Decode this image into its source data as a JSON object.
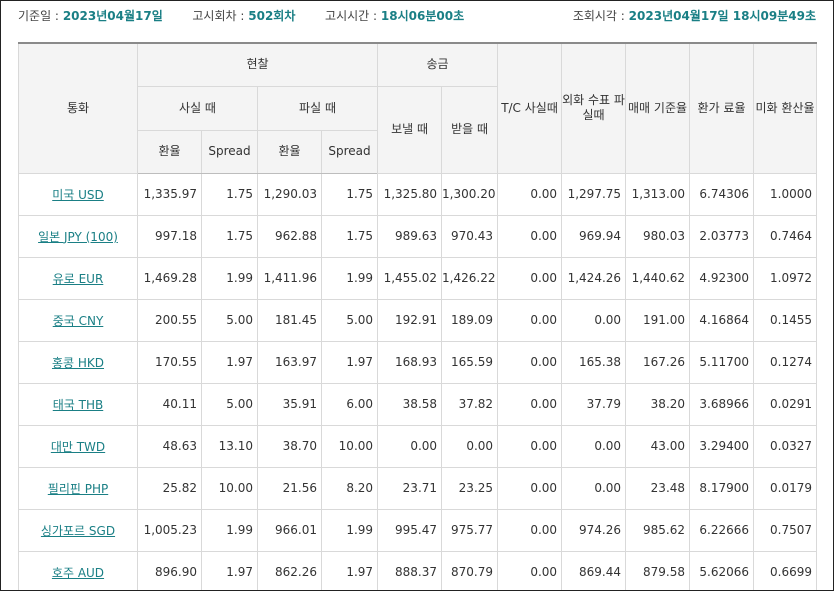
{
  "info": {
    "base_date_label": "기준일 :",
    "base_date_value": "2023년04월17일",
    "notice_round_label": "고시회차 :",
    "notice_round_value": "502회차",
    "notice_time_label": "고시시간 :",
    "notice_time_value": "18시06분00초",
    "query_time_label": "조회시각 :",
    "query_time_value": "2023년04월17일 18시09분49초"
  },
  "headers": {
    "currency": "통화",
    "cash": "현찰",
    "remit": "송금",
    "tc_buy": "T/C 사실때",
    "foreign_check_sell": "외화 수표 파실때",
    "base_rate": "매매 기준율",
    "conversion_rate": "환가 료율",
    "usd_conversion": "미화 환산율",
    "cash_buy": "사실 때",
    "cash_sell": "파실 때",
    "remit_send": "보낼 때",
    "remit_receive": "받을 때",
    "rate": "환율",
    "spread": "Spread"
  },
  "rows": [
    {
      "name": "미국 USD",
      "cash_buy_rate": "1,335.97",
      "cash_buy_spread": "1.75",
      "cash_sell_rate": "1,290.03",
      "cash_sell_spread": "1.75",
      "remit_send": "1,325.80",
      "remit_receive": "1,300.20",
      "tc_buy": "0.00",
      "check_sell": "1,297.75",
      "base_rate": "1,313.00",
      "conv_rate": "6.74306",
      "usd_conv": "1.0000"
    },
    {
      "name": "일본 JPY (100)",
      "cash_buy_rate": "997.18",
      "cash_buy_spread": "1.75",
      "cash_sell_rate": "962.88",
      "cash_sell_spread": "1.75",
      "remit_send": "989.63",
      "remit_receive": "970.43",
      "tc_buy": "0.00",
      "check_sell": "969.94",
      "base_rate": "980.03",
      "conv_rate": "2.03773",
      "usd_conv": "0.7464"
    },
    {
      "name": "유로 EUR",
      "cash_buy_rate": "1,469.28",
      "cash_buy_spread": "1.99",
      "cash_sell_rate": "1,411.96",
      "cash_sell_spread": "1.99",
      "remit_send": "1,455.02",
      "remit_receive": "1,426.22",
      "tc_buy": "0.00",
      "check_sell": "1,424.26",
      "base_rate": "1,440.62",
      "conv_rate": "4.92300",
      "usd_conv": "1.0972"
    },
    {
      "name": "중국 CNY",
      "cash_buy_rate": "200.55",
      "cash_buy_spread": "5.00",
      "cash_sell_rate": "181.45",
      "cash_sell_spread": "5.00",
      "remit_send": "192.91",
      "remit_receive": "189.09",
      "tc_buy": "0.00",
      "check_sell": "0.00",
      "base_rate": "191.00",
      "conv_rate": "4.16864",
      "usd_conv": "0.1455"
    },
    {
      "name": "홍콩 HKD",
      "cash_buy_rate": "170.55",
      "cash_buy_spread": "1.97",
      "cash_sell_rate": "163.97",
      "cash_sell_spread": "1.97",
      "remit_send": "168.93",
      "remit_receive": "165.59",
      "tc_buy": "0.00",
      "check_sell": "165.38",
      "base_rate": "167.26",
      "conv_rate": "5.11700",
      "usd_conv": "0.1274"
    },
    {
      "name": "태국 THB",
      "cash_buy_rate": "40.11",
      "cash_buy_spread": "5.00",
      "cash_sell_rate": "35.91",
      "cash_sell_spread": "6.00",
      "remit_send": "38.58",
      "remit_receive": "37.82",
      "tc_buy": "0.00",
      "check_sell": "37.79",
      "base_rate": "38.20",
      "conv_rate": "3.68966",
      "usd_conv": "0.0291"
    },
    {
      "name": "대만 TWD",
      "cash_buy_rate": "48.63",
      "cash_buy_spread": "13.10",
      "cash_sell_rate": "38.70",
      "cash_sell_spread": "10.00",
      "remit_send": "0.00",
      "remit_receive": "0.00",
      "tc_buy": "0.00",
      "check_sell": "0.00",
      "base_rate": "43.00",
      "conv_rate": "3.29400",
      "usd_conv": "0.0327"
    },
    {
      "name": "필리핀 PHP",
      "cash_buy_rate": "25.82",
      "cash_buy_spread": "10.00",
      "cash_sell_rate": "21.56",
      "cash_sell_spread": "8.20",
      "remit_send": "23.71",
      "remit_receive": "23.25",
      "tc_buy": "0.00",
      "check_sell": "0.00",
      "base_rate": "23.48",
      "conv_rate": "8.17900",
      "usd_conv": "0.0179"
    },
    {
      "name": "싱가포르 SGD",
      "cash_buy_rate": "1,005.23",
      "cash_buy_spread": "1.99",
      "cash_sell_rate": "966.01",
      "cash_sell_spread": "1.99",
      "remit_send": "995.47",
      "remit_receive": "975.77",
      "tc_buy": "0.00",
      "check_sell": "974.26",
      "base_rate": "985.62",
      "conv_rate": "6.22666",
      "usd_conv": "0.7507"
    },
    {
      "name": "호주 AUD",
      "cash_buy_rate": "896.90",
      "cash_buy_spread": "1.97",
      "cash_sell_rate": "862.26",
      "cash_sell_spread": "1.97",
      "remit_send": "888.37",
      "remit_receive": "870.79",
      "tc_buy": "0.00",
      "check_sell": "869.44",
      "base_rate": "879.58",
      "conv_rate": "5.62066",
      "usd_conv": "0.6699"
    }
  ],
  "colors": {
    "accent": "#1a7f85",
    "header_bg": "#f4f4f4",
    "grid": "#d9d9d9"
  }
}
